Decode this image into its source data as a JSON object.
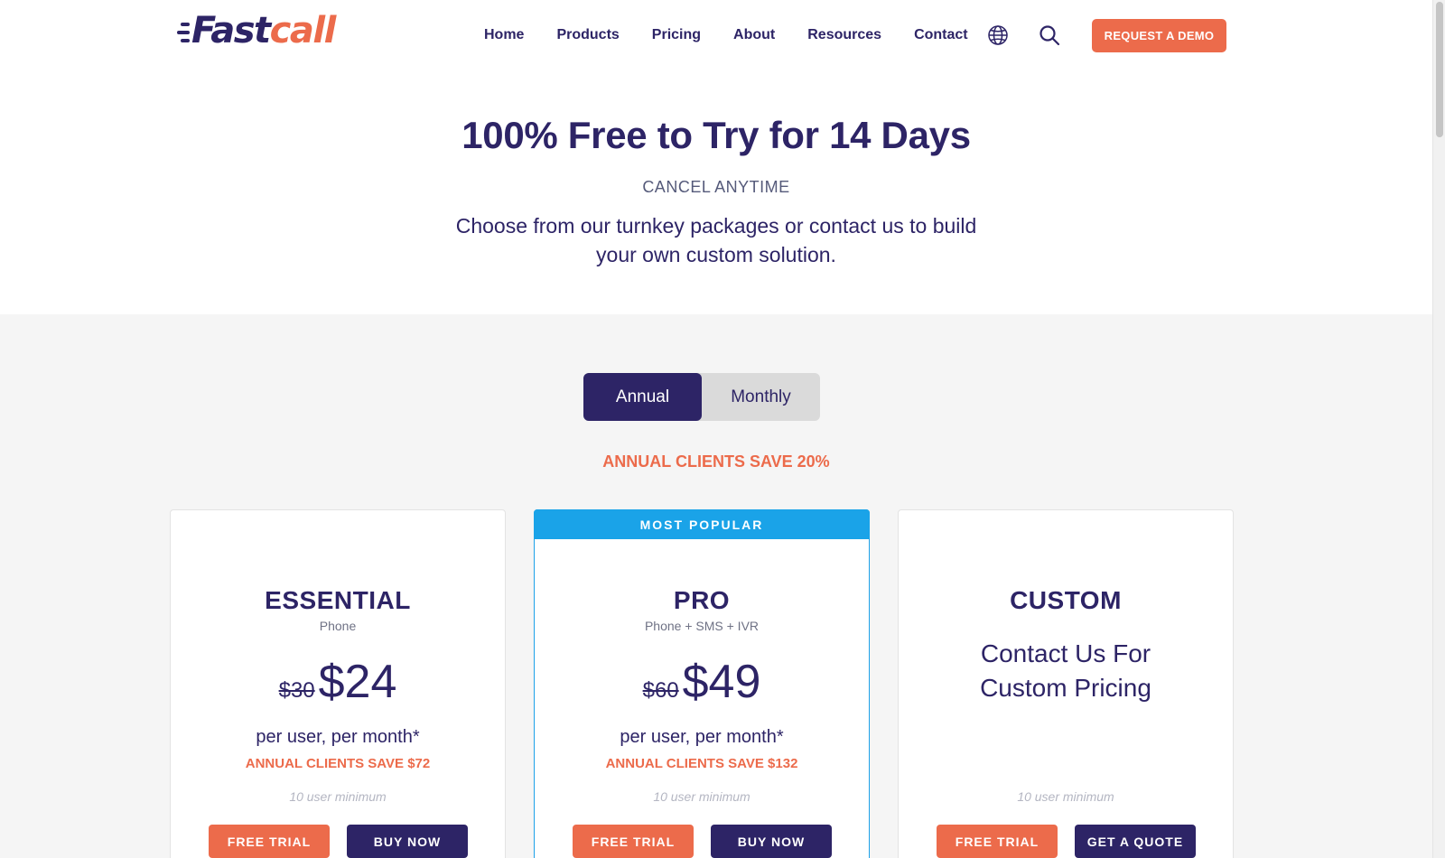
{
  "brand": {
    "logo_fast": "Fast",
    "logo_call": "call"
  },
  "nav": {
    "items": [
      "Home",
      "Products",
      "Pricing",
      "About",
      "Resources",
      "Contact"
    ],
    "demo_button": "REQUEST A DEMO"
  },
  "hero": {
    "title": "100% Free to Try for 14 Days",
    "subtitle": "CANCEL ANYTIME",
    "description": "Choose from our turnkey packages or contact us to build your own custom solution."
  },
  "billing_toggle": {
    "annual": "Annual",
    "monthly": "Monthly",
    "selected": "Annual"
  },
  "save_note": "ANNUAL CLIENTS SAVE 20%",
  "plans": [
    {
      "title": "ESSENTIAL",
      "subtitle": "Phone",
      "old_price": "$30",
      "price": "$24",
      "per": "per user, per month*",
      "save": "ANNUAL CLIENTS SAVE $72",
      "minimum": "10 user minimum",
      "primary_button": "FREE TRIAL",
      "secondary_button": "BUY NOW"
    },
    {
      "badge": "MOST POPULAR",
      "title": "PRO",
      "subtitle": "Phone + SMS + IVR",
      "old_price": "$60",
      "price": "$49",
      "per": "per user, per month*",
      "save": "ANNUAL CLIENTS SAVE $132",
      "minimum": "10 user minimum",
      "primary_button": "FREE TRIAL",
      "secondary_button": "BUY NOW"
    },
    {
      "title": "CUSTOM",
      "contact_text": "Contact Us For Custom Pricing",
      "minimum": "10 user minimum",
      "primary_button": "FREE TRIAL",
      "secondary_button": "GET A QUOTE"
    }
  ],
  "colors": {
    "navy": "#2d2466",
    "orange": "#ec6b4b",
    "blue_badge": "#1aa3e8",
    "section_bg": "#f5f5f5"
  },
  "icons": {
    "language": "globe-icon",
    "search": "search-icon"
  }
}
